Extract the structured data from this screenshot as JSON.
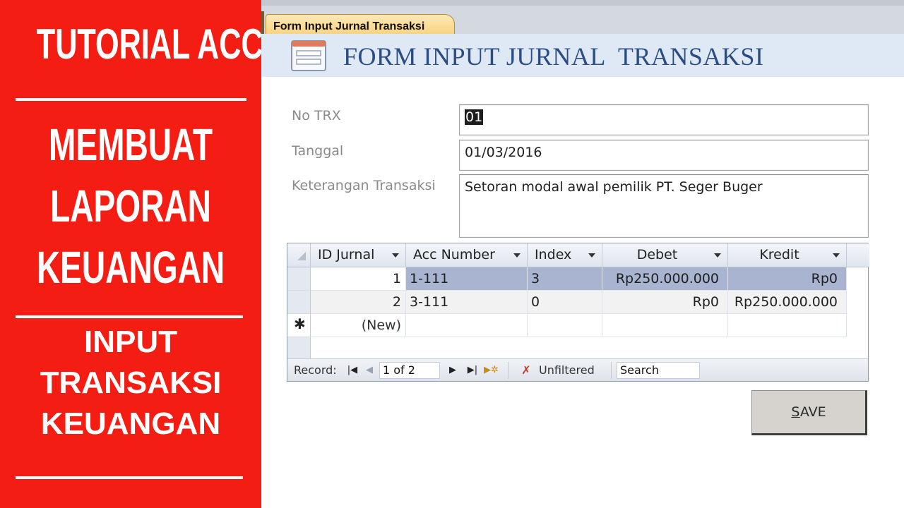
{
  "banner": {
    "line1": "TUTORIAL ACCESS",
    "heading": [
      "MEMBUAT",
      "LAPORAN",
      "KEUANGAN"
    ],
    "subheading": [
      "INPUT",
      "TRANSAKSI",
      "KEUANGAN"
    ],
    "bg_color": "#f31d13"
  },
  "window": {
    "tab_label": "Form Input Jurnal Transaksi",
    "form_title": "FORM INPUT JURNAL  TRANSAKSI",
    "title_color": "#2b4d84"
  },
  "fields": {
    "no_trx": {
      "label": "No TRX",
      "value": "01"
    },
    "tanggal": {
      "label": "Tanggal",
      "value": "01/03/2016"
    },
    "keterangan": {
      "label": "Keterangan Transaksi",
      "value": "Setoran modal awal pemilik PT. Seger Buger"
    }
  },
  "subform": {
    "columns": [
      "ID Jurnal",
      "Acc Number",
      "Index",
      "Debet",
      "Kredit"
    ],
    "rows": [
      {
        "id": "1",
        "acc": "1-111",
        "index": "3",
        "debet": "Rp250.000.000",
        "kredit": "Rp0"
      },
      {
        "id": "2",
        "acc": "3-111",
        "index": "0",
        "debet": "Rp0",
        "kredit": "Rp250.000.000"
      }
    ],
    "new_row_marker": "✱",
    "new_row_label": "(New)",
    "selected_color": "#a8b4d0"
  },
  "navigation": {
    "record_label": "Record:",
    "position": "1 of 2",
    "filter_label": "Unfiltered",
    "search_label": "Search",
    "icons": [
      "first-record-icon",
      "previous-record-icon",
      "next-record-icon",
      "last-record-icon",
      "new-record-icon",
      "filter-icon"
    ]
  },
  "actions": {
    "save_label_first": "S",
    "save_label_rest": "AVE"
  }
}
